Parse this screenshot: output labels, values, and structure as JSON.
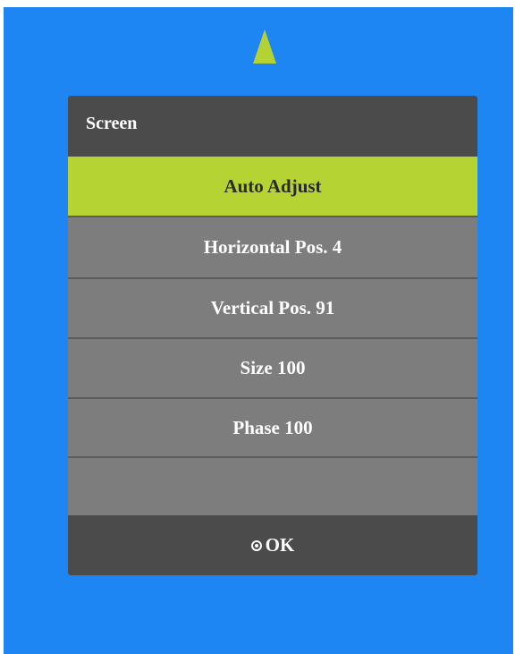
{
  "menu": {
    "title": "Screen",
    "items": [
      {
        "label": "Auto Adjust",
        "selected": true
      },
      {
        "label": "Horizontal Pos.  4",
        "selected": false
      },
      {
        "label": "Vertical Pos.  91",
        "selected": false
      },
      {
        "label": "Size  100",
        "selected": false
      },
      {
        "label": "Phase  100",
        "selected": false
      },
      {
        "label": "",
        "selected": false
      }
    ],
    "footer": {
      "icon": "ok-circle-icon",
      "label": "OK"
    }
  },
  "colors": {
    "background": "#1e86f2",
    "accent": "#b6d334",
    "panel_dark": "#4b4b4b",
    "row": "#7d7d7d"
  }
}
